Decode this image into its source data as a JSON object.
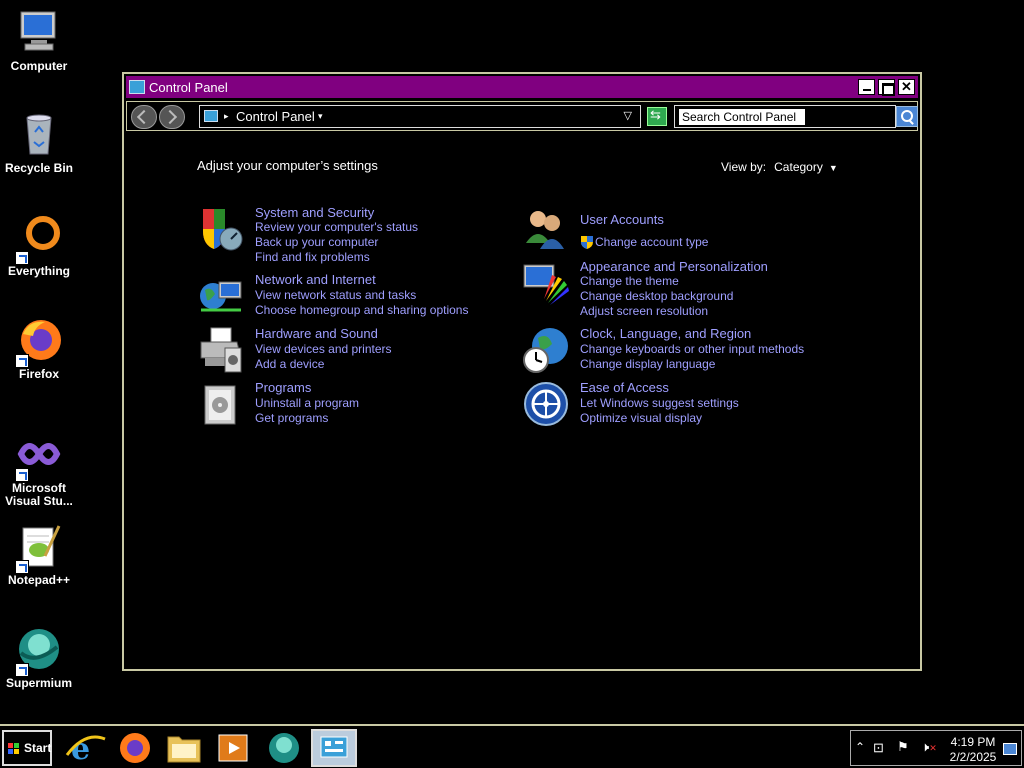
{
  "desktop": {
    "icons": [
      {
        "label": "Computer"
      },
      {
        "label": "Recycle Bin"
      },
      {
        "label": "Everything"
      },
      {
        "label": "Firefox"
      },
      {
        "label": "Microsoft Visual Stu..."
      },
      {
        "label": "Notepad++"
      },
      {
        "label": "Supermium"
      }
    ]
  },
  "window": {
    "title": "Control Panel",
    "address": {
      "breadcrumb": "Control Panel",
      "search_placeholder": "Search Control Panel"
    },
    "content": {
      "heading": "Adjust your computer’s settings",
      "view_by_label": "View by:",
      "view_by_value": "Category",
      "categories_left": [
        {
          "title": "System and Security",
          "links": [
            "Review your computer's status",
            "Back up your computer",
            "Find and fix problems"
          ]
        },
        {
          "title": "Network and Internet",
          "links": [
            "View network status and tasks",
            "Choose homegroup and sharing options"
          ]
        },
        {
          "title": "Hardware and Sound",
          "links": [
            "View devices and printers",
            "Add a device"
          ]
        },
        {
          "title": "Programs",
          "links": [
            "Uninstall a program",
            "Get programs"
          ]
        }
      ],
      "categories_right": [
        {
          "title": "User Accounts",
          "links": [
            "Change account type"
          ]
        },
        {
          "title": "Appearance and Personalization",
          "links": [
            "Change the theme",
            "Change desktop background",
            "Adjust screen resolution"
          ]
        },
        {
          "title": "Clock, Language, and Region",
          "links": [
            "Change keyboards or other input methods",
            "Change display language"
          ]
        },
        {
          "title": "Ease of Access",
          "links": [
            "Let Windows suggest settings",
            "Optimize visual display"
          ]
        }
      ]
    }
  },
  "taskbar": {
    "start_label": "Start",
    "clock_time": "4:19 PM",
    "clock_date": "2/2/2025"
  },
  "colors": {
    "titlebar": "#800080",
    "link": "#9f9fff",
    "border": "#c9c9a4"
  }
}
